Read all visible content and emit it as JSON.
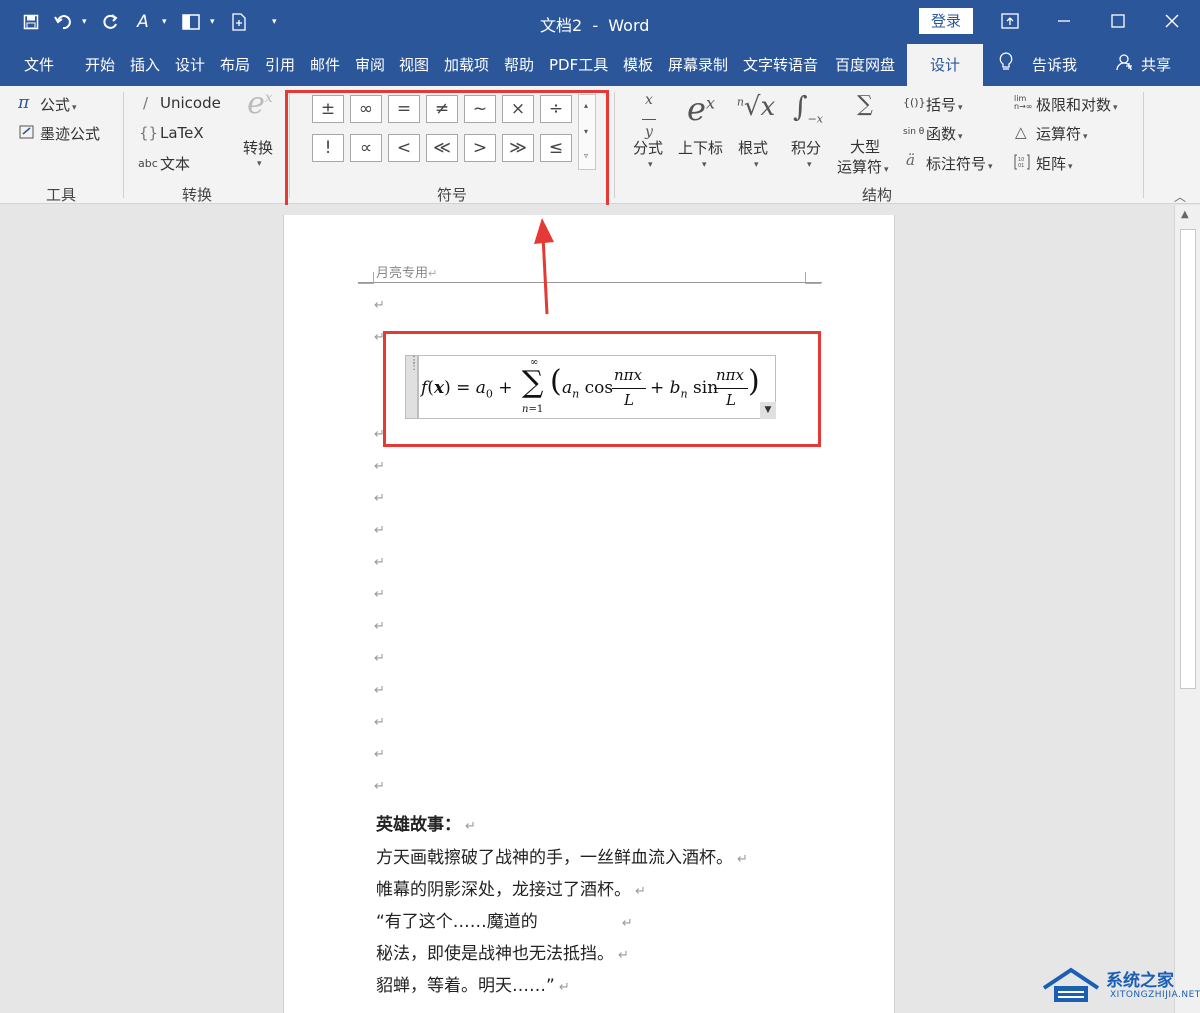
{
  "titlebar": {
    "title": "文档2  -  Word",
    "login_label": "登录",
    "qat_icons": [
      "save-icon",
      "undo-icon",
      "redo-icon",
      "format-painter-icon",
      "layout-icon",
      "new-doc-icon",
      "customize-qat-icon"
    ],
    "window_controls": [
      "ribbon-display-icon",
      "minimize-icon",
      "maximize-icon",
      "close-icon"
    ]
  },
  "tabs": [
    {
      "label": "文件"
    },
    {
      "label": "开始"
    },
    {
      "label": "插入"
    },
    {
      "label": "设计"
    },
    {
      "label": "布局"
    },
    {
      "label": "引用"
    },
    {
      "label": "邮件"
    },
    {
      "label": "审阅"
    },
    {
      "label": "视图"
    },
    {
      "label": "加载项"
    },
    {
      "label": "帮助"
    },
    {
      "label": "PDF工具"
    },
    {
      "label": "模板"
    },
    {
      "label": "屏幕录制"
    },
    {
      "label": "文字转语音"
    },
    {
      "label": "百度网盘"
    }
  ],
  "active_tab": "设计",
  "tell_me": "告诉我",
  "share": "共享",
  "ribbon": {
    "tools": {
      "equation": "公式",
      "equation_icon_text": "π",
      "ink_equation": "墨迹公式",
      "group_label": "工具"
    },
    "convert": {
      "unicode": "Unicode",
      "latex": "LaTeX",
      "text": "文本",
      "text_prefix": "abc",
      "convert_label": "转换",
      "group_label": "转换"
    },
    "symbols": {
      "row1": [
        "±",
        "∞",
        "=",
        "≠",
        "~",
        "×",
        "÷"
      ],
      "row2": [
        "!",
        "∝",
        "<",
        "≪",
        ">",
        "≫",
        "≤"
      ],
      "group_label": "符号"
    },
    "structures": {
      "fraction": "分式",
      "script": "上下标",
      "radical": "根式",
      "integral": "积分",
      "large_operator_line1": "大型",
      "large_operator_line2": "运算符",
      "bracket": "括号",
      "function": "函数",
      "function_prefix": "sin θ",
      "accent": "标注符号",
      "limit_log": "极限和对数",
      "operator": "运算符",
      "matrix": "矩阵",
      "group_label": "结构"
    }
  },
  "document": {
    "header_text": "月亮专用",
    "heading": "英雄故事：",
    "lines": [
      "方天画戟擦破了战神的手，一丝鲜血流入酒杯。",
      "帷幕的阴影深处，龙接过了酒杯。",
      "“有了这个……魔道的",
      "秘法，即使是战神也无法抵挡。",
      "貂蝉，等着。明天……”"
    ],
    "paragraph_mark": "↵"
  },
  "watermark": {
    "name": "系统之家",
    "url": "XITONGZHIJIA.NET"
  },
  "colors": {
    "brand": "#2b579a",
    "highlight": "#e53935"
  }
}
